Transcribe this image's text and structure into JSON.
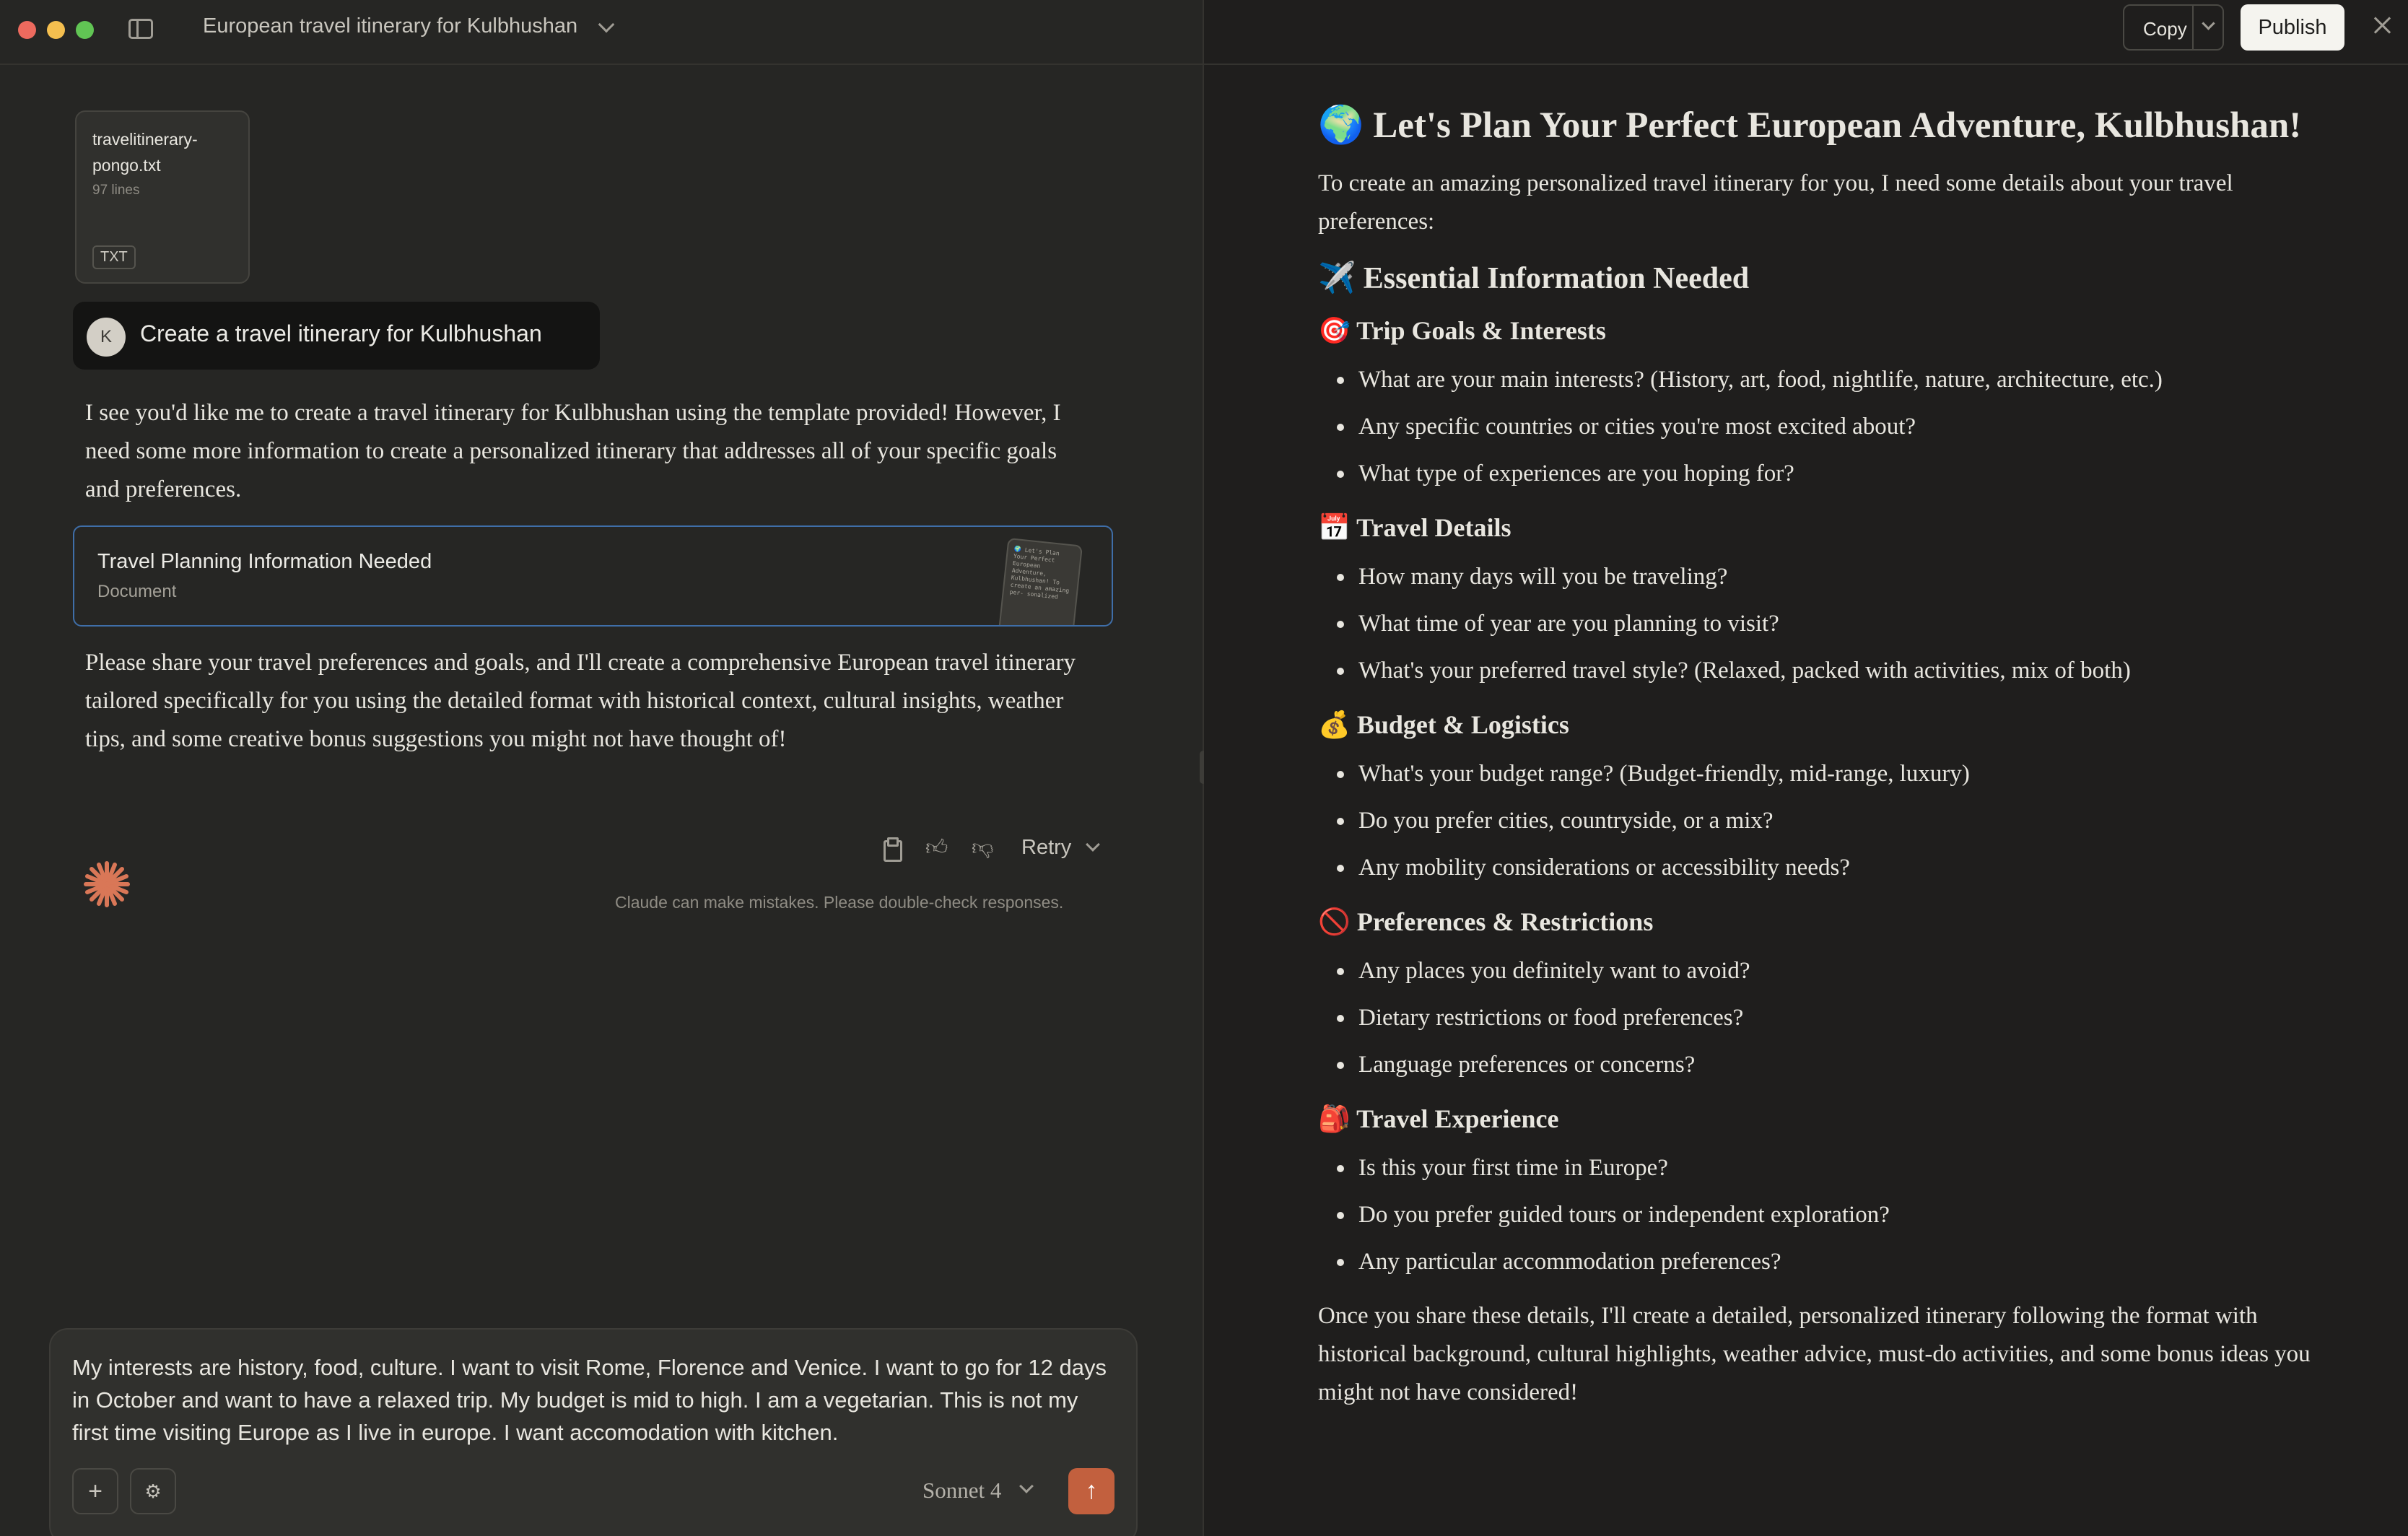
{
  "conversation": {
    "title": "European travel itinerary for Kulbhushan"
  },
  "attachment": {
    "filename": "travelitinerary-pongo.txt",
    "lines": "97 lines",
    "badge": "TXT"
  },
  "user_message": {
    "avatar_initial": "K",
    "text": "Create a travel itinerary for Kulbhushan"
  },
  "assistant": {
    "para1": "I see you'd like me to create a travel itinerary for Kulbhushan using the template provided! However, I need some more information to create a personalized itinerary that addresses all of your specific goals and preferences.",
    "artifact": {
      "title": "Travel Planning Information Needed",
      "type": "Document",
      "thumb_text": "🌍 Let's Plan Your Perfect European Adventure, Kulbhushan! To create an amazing per- sonalized"
    },
    "para2": "Please share your travel preferences and goals, and I'll create a comprehensive European travel itinerary tailored specifically for you using the detailed format with historical context, cultural insights, weather tips, and some creative bonus suggestions you might not have thought of!",
    "retry_label": "Retry",
    "disclaimer": "Claude can make mistakes. Please double-check responses."
  },
  "composer": {
    "text": "My interests are history, food, culture. I want to visit Rome, Florence and Venice. I want to go for 12 days in October and want to have a relaxed trip. My budget is mid to high. I am a vegetarian. This is not my first time visiting Europe as I live in europe. I want accomodation with kitchen.",
    "model": "Sonnet 4"
  },
  "artifact_panel": {
    "copy_label": "Copy",
    "publish_label": "Publish",
    "title": "🌍 Let's Plan Your Perfect European Adventure, Kulbhushan!",
    "intro": "To create an amazing personalized travel itinerary for you, I need some details about your travel preferences:",
    "h2": "✈️ Essential Information Needed",
    "sections": [
      {
        "heading": "🎯 Trip Goals & Interests",
        "items": [
          "What are your main interests? (History, art, food, nightlife, nature, architecture, etc.)",
          "Any specific countries or cities you're most excited about?",
          "What type of experiences are you hoping for?"
        ]
      },
      {
        "heading": "📅 Travel Details",
        "items": [
          "How many days will you be traveling?",
          "What time of year are you planning to visit?",
          "What's your preferred travel style? (Relaxed, packed with activities, mix of both)"
        ]
      },
      {
        "heading": "💰 Budget & Logistics",
        "items": [
          "What's your budget range? (Budget-friendly, mid-range, luxury)",
          "Do you prefer cities, countryside, or a mix?",
          "Any mobility considerations or accessibility needs?"
        ]
      },
      {
        "heading": "🚫 Preferences & Restrictions",
        "items": [
          "Any places you definitely want to avoid?",
          "Dietary restrictions or food preferences?",
          "Language preferences or concerns?"
        ]
      },
      {
        "heading": "🎒 Travel Experience",
        "items": [
          "Is this your first time in Europe?",
          "Do you prefer guided tours or independent exploration?",
          "Any particular accommodation preferences?"
        ]
      }
    ],
    "outro": "Once you share these details, I'll create a detailed, personalized itinerary following the format with historical background, cultural highlights, weather advice, must-do activities, and some bonus ideas you might not have considered!"
  },
  "colors": {
    "background": "#262624",
    "artifact_background": "#1f1e1d",
    "accent": "#c2603e",
    "artifact_border": "#3f6ea8"
  }
}
